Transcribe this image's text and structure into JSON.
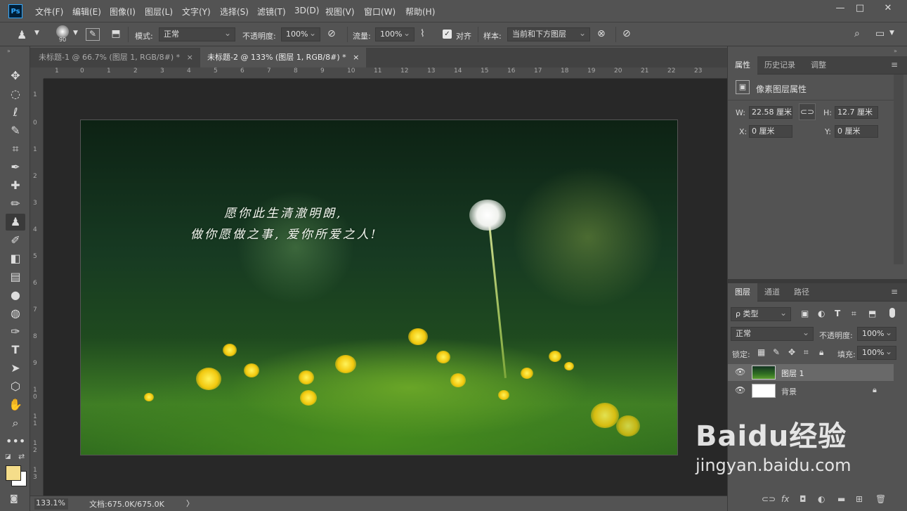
{
  "app": {
    "logo": "Ps"
  },
  "menu": [
    "文件(F)",
    "编辑(E)",
    "图像(I)",
    "图层(L)",
    "文字(Y)",
    "选择(S)",
    "滤镜(T)",
    "3D(D)",
    "视图(V)",
    "窗口(W)",
    "帮助(H)"
  ],
  "window_controls": {
    "minimize": "—",
    "restore": "□",
    "close": "✕"
  },
  "options": {
    "brush_size": "90",
    "mode_label": "模式:",
    "mode_value": "正常",
    "opacity_label": "不透明度:",
    "opacity_value": "100%",
    "flow_label": "流量:",
    "flow_value": "100%",
    "align_label": "对齐",
    "sample_label": "样本:",
    "sample_value": "当前和下方图层"
  },
  "tabs": [
    {
      "label": "未标题-1 @ 66.7% (图层 1, RGB/8#) *",
      "close": "×"
    },
    {
      "label": "未标题-2 @ 133% (图层 1, RGB/8#) *",
      "close": "×"
    }
  ],
  "ruler_h": [
    "1",
    "0",
    "1",
    "2",
    "3",
    "4",
    "5",
    "6",
    "7",
    "8",
    "9",
    "10",
    "11",
    "12",
    "13",
    "14",
    "15",
    "16",
    "17",
    "18",
    "19",
    "20",
    "21",
    "22",
    "23"
  ],
  "ruler_v": [
    "1",
    "0",
    "1",
    "2",
    "3",
    "4",
    "5",
    "6",
    "7",
    "8",
    "9",
    "1 0",
    "1 1",
    "1 2",
    "1 3"
  ],
  "canvas": {
    "poem_line1": "愿你此生清澈明朗,",
    "poem_line2": "做你愿做之事, 爱你所爱之人!"
  },
  "status": {
    "zoom": "133.1%",
    "doc": "文档:675.0K/675.0K",
    "arrow": "〉"
  },
  "properties_panel": {
    "tabs": [
      "属性",
      "历史记录",
      "调整"
    ],
    "header": "像素图层属性",
    "w_label": "W:",
    "w_value": "22.58 厘米",
    "h_label": "H:",
    "h_value": "12.7 厘米",
    "x_label": "X:",
    "x_value": "0 厘米",
    "y_label": "Y:",
    "y_value": "0 厘米"
  },
  "layers_panel": {
    "tabs": [
      "图层",
      "通道",
      "路径"
    ],
    "filter_label": "ρ 类型",
    "blend_mode": "正常",
    "opacity_label": "不透明度:",
    "opacity_value": "100%",
    "lock_label": "锁定:",
    "fill_label": "填充:",
    "fill_value": "100%",
    "layers": [
      {
        "name": "图层 1"
      },
      {
        "name": "背景"
      }
    ]
  },
  "watermark": {
    "brand": "Baidu经验",
    "url": "jingyan.baidu.com"
  },
  "colors": {
    "foreground": "#f5dd8a",
    "background": "#ffffff",
    "accent": "#31a8ff"
  }
}
